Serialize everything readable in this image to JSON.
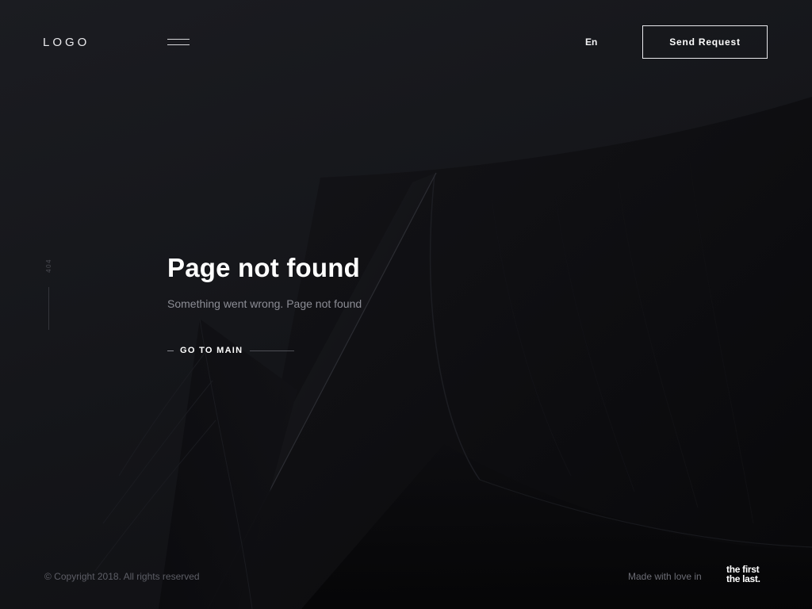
{
  "header": {
    "logo": "LOGO",
    "language": "En",
    "send_request_label": "Send Request"
  },
  "error": {
    "code": "404",
    "title": "Page not found",
    "message": "Something went wrong. Page not found",
    "go_main_label": "GO TO MAIN"
  },
  "footer": {
    "copyright": "© Copyright 2018. All rights reserved",
    "made_with": "Made with love in",
    "brand_line1": "the first",
    "brand_line2": "the last."
  },
  "icons": {
    "menu": "hamburger-menu-icon"
  },
  "colors": {
    "background": "#15161a",
    "text_primary": "#ffffff",
    "text_muted": "#8c8d95"
  }
}
